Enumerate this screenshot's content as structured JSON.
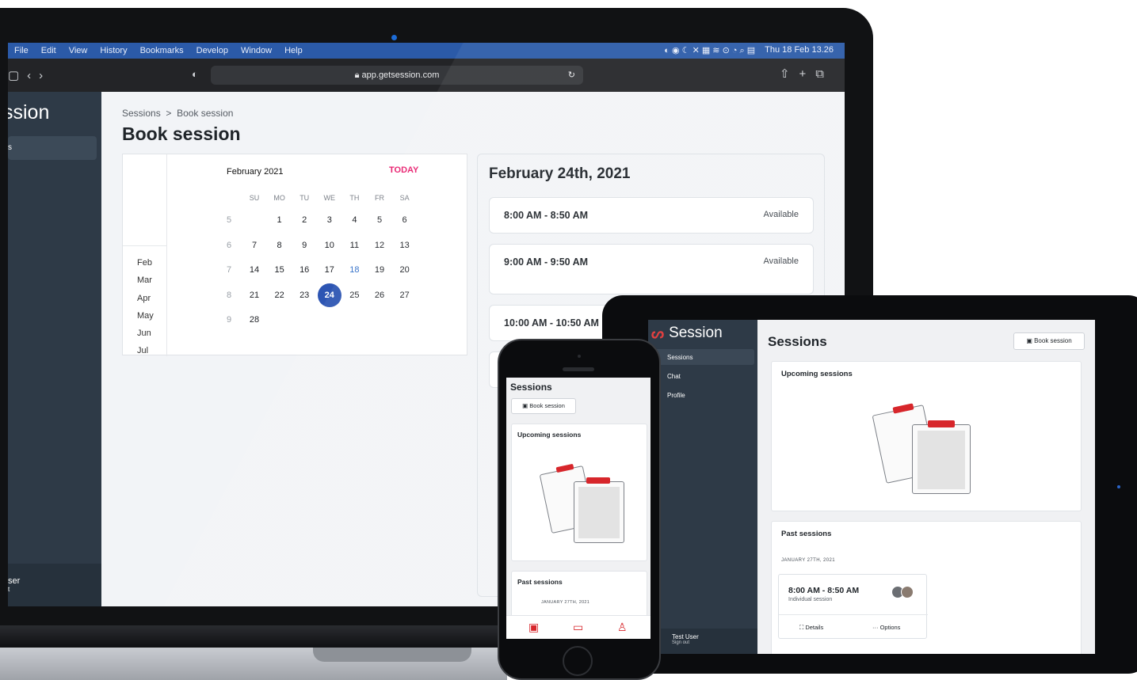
{
  "laptop": {
    "menubar": {
      "items": [
        "File",
        "Edit",
        "View",
        "History",
        "Bookmarks",
        "Develop",
        "Window",
        "Help"
      ],
      "datetime": "Thu 18 Feb 13.26"
    },
    "browser": {
      "url": "app.getsession.com"
    },
    "sidebar": {
      "brand": "ssion",
      "active_item": "s",
      "user_name": "ser",
      "user_sub": "t"
    },
    "main": {
      "breadcrumb": [
        "Sessions",
        "Book session"
      ],
      "breadcrumb_sep": ">",
      "title": "Book session"
    },
    "calendar": {
      "month_label": "February 2021",
      "today_label": "TODAY",
      "months": [
        "Feb",
        "Mar",
        "Apr",
        "May",
        "Jun",
        "Jul"
      ],
      "weekdays": [
        "SU",
        "MO",
        "TU",
        "WE",
        "TH",
        "FR",
        "SA"
      ],
      "weeks": [
        {
          "wk": "5",
          "days": [
            "",
            "1",
            "2",
            "3",
            "4",
            "5",
            "6"
          ]
        },
        {
          "wk": "6",
          "days": [
            "7",
            "8",
            "9",
            "10",
            "11",
            "12",
            "13"
          ]
        },
        {
          "wk": "7",
          "days": [
            "14",
            "15",
            "16",
            "17",
            "18",
            "19",
            "20"
          ]
        },
        {
          "wk": "8",
          "days": [
            "21",
            "22",
            "23",
            "24",
            "25",
            "26",
            "27"
          ]
        },
        {
          "wk": "9",
          "days": [
            "28",
            "",
            "",
            "",
            "",
            "",
            ""
          ]
        }
      ],
      "selected_day": "24",
      "highlight_day": "18"
    },
    "slots": {
      "date": "February 24th, 2021",
      "items": [
        {
          "time": "8:00 AM - 8:50 AM",
          "status": "Available"
        },
        {
          "time": "9:00 AM - 9:50 AM",
          "status": "Available"
        },
        {
          "time": "10:00 AM - 10:50 AM",
          "status": ""
        }
      ]
    }
  },
  "tablet": {
    "sidebar": {
      "brand": "Session",
      "items": [
        "Sessions",
        "Chat",
        "Profile"
      ],
      "user_name": "Test User",
      "sign_out": "Sign out"
    },
    "main": {
      "title": "Sessions",
      "book_button": "Book session",
      "upcoming_header": "Upcoming sessions",
      "past_header": "Past sessions",
      "past_date": "JANUARY 27TH, 2021",
      "session_time": "8:00 AM - 8:50 AM",
      "session_type": "Individual session",
      "details_label": "Details",
      "options_label": "Options"
    }
  },
  "phone": {
    "title": "Sessions",
    "book_button": "Book session",
    "upcoming_header": "Upcoming sessions",
    "past_header": "Past sessions",
    "past_date": "JANUARY 27TH, 2021"
  },
  "colors": {
    "sidebar": "#2e3a47",
    "accent_blue": "#2d55b3",
    "today_pink": "#e8206f",
    "brand_red": "#d7262b"
  }
}
